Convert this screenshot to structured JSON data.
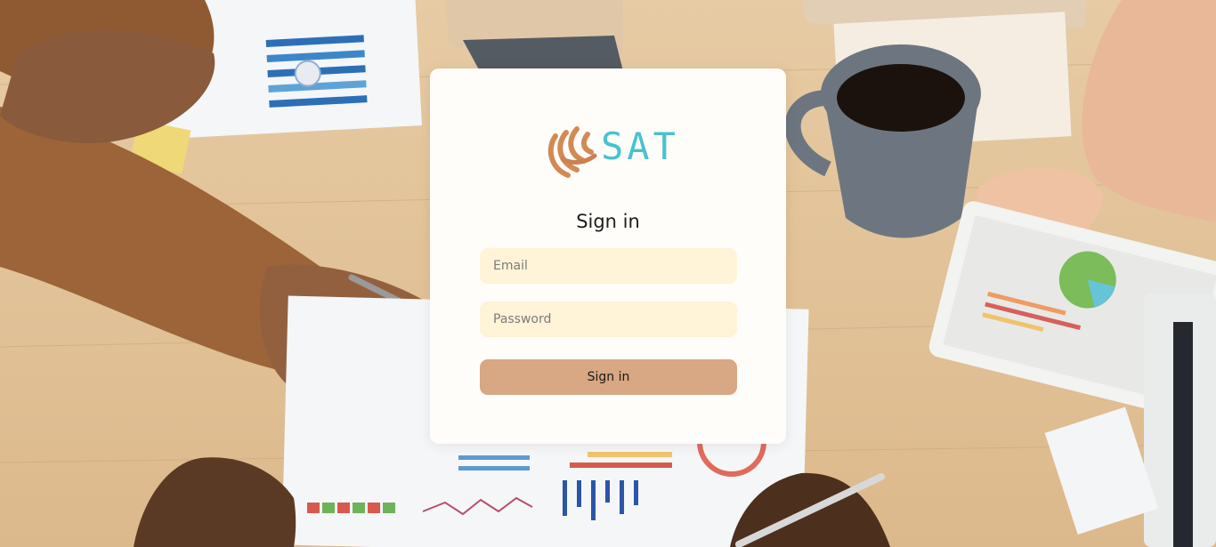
{
  "logo": {
    "text": "SAT",
    "icon": "fingerprint-swirl-icon",
    "icon_color": "#d28a55",
    "text_color": "#48c2d0"
  },
  "signin": {
    "title": "Sign in",
    "email_placeholder": "Email",
    "email_value": "",
    "password_placeholder": "Password",
    "password_value": "",
    "button_label": "Sign in"
  },
  "colors": {
    "input_bg": "#fff3d8",
    "button_bg": "#d8a783",
    "card_bg": "#fffdfa"
  }
}
